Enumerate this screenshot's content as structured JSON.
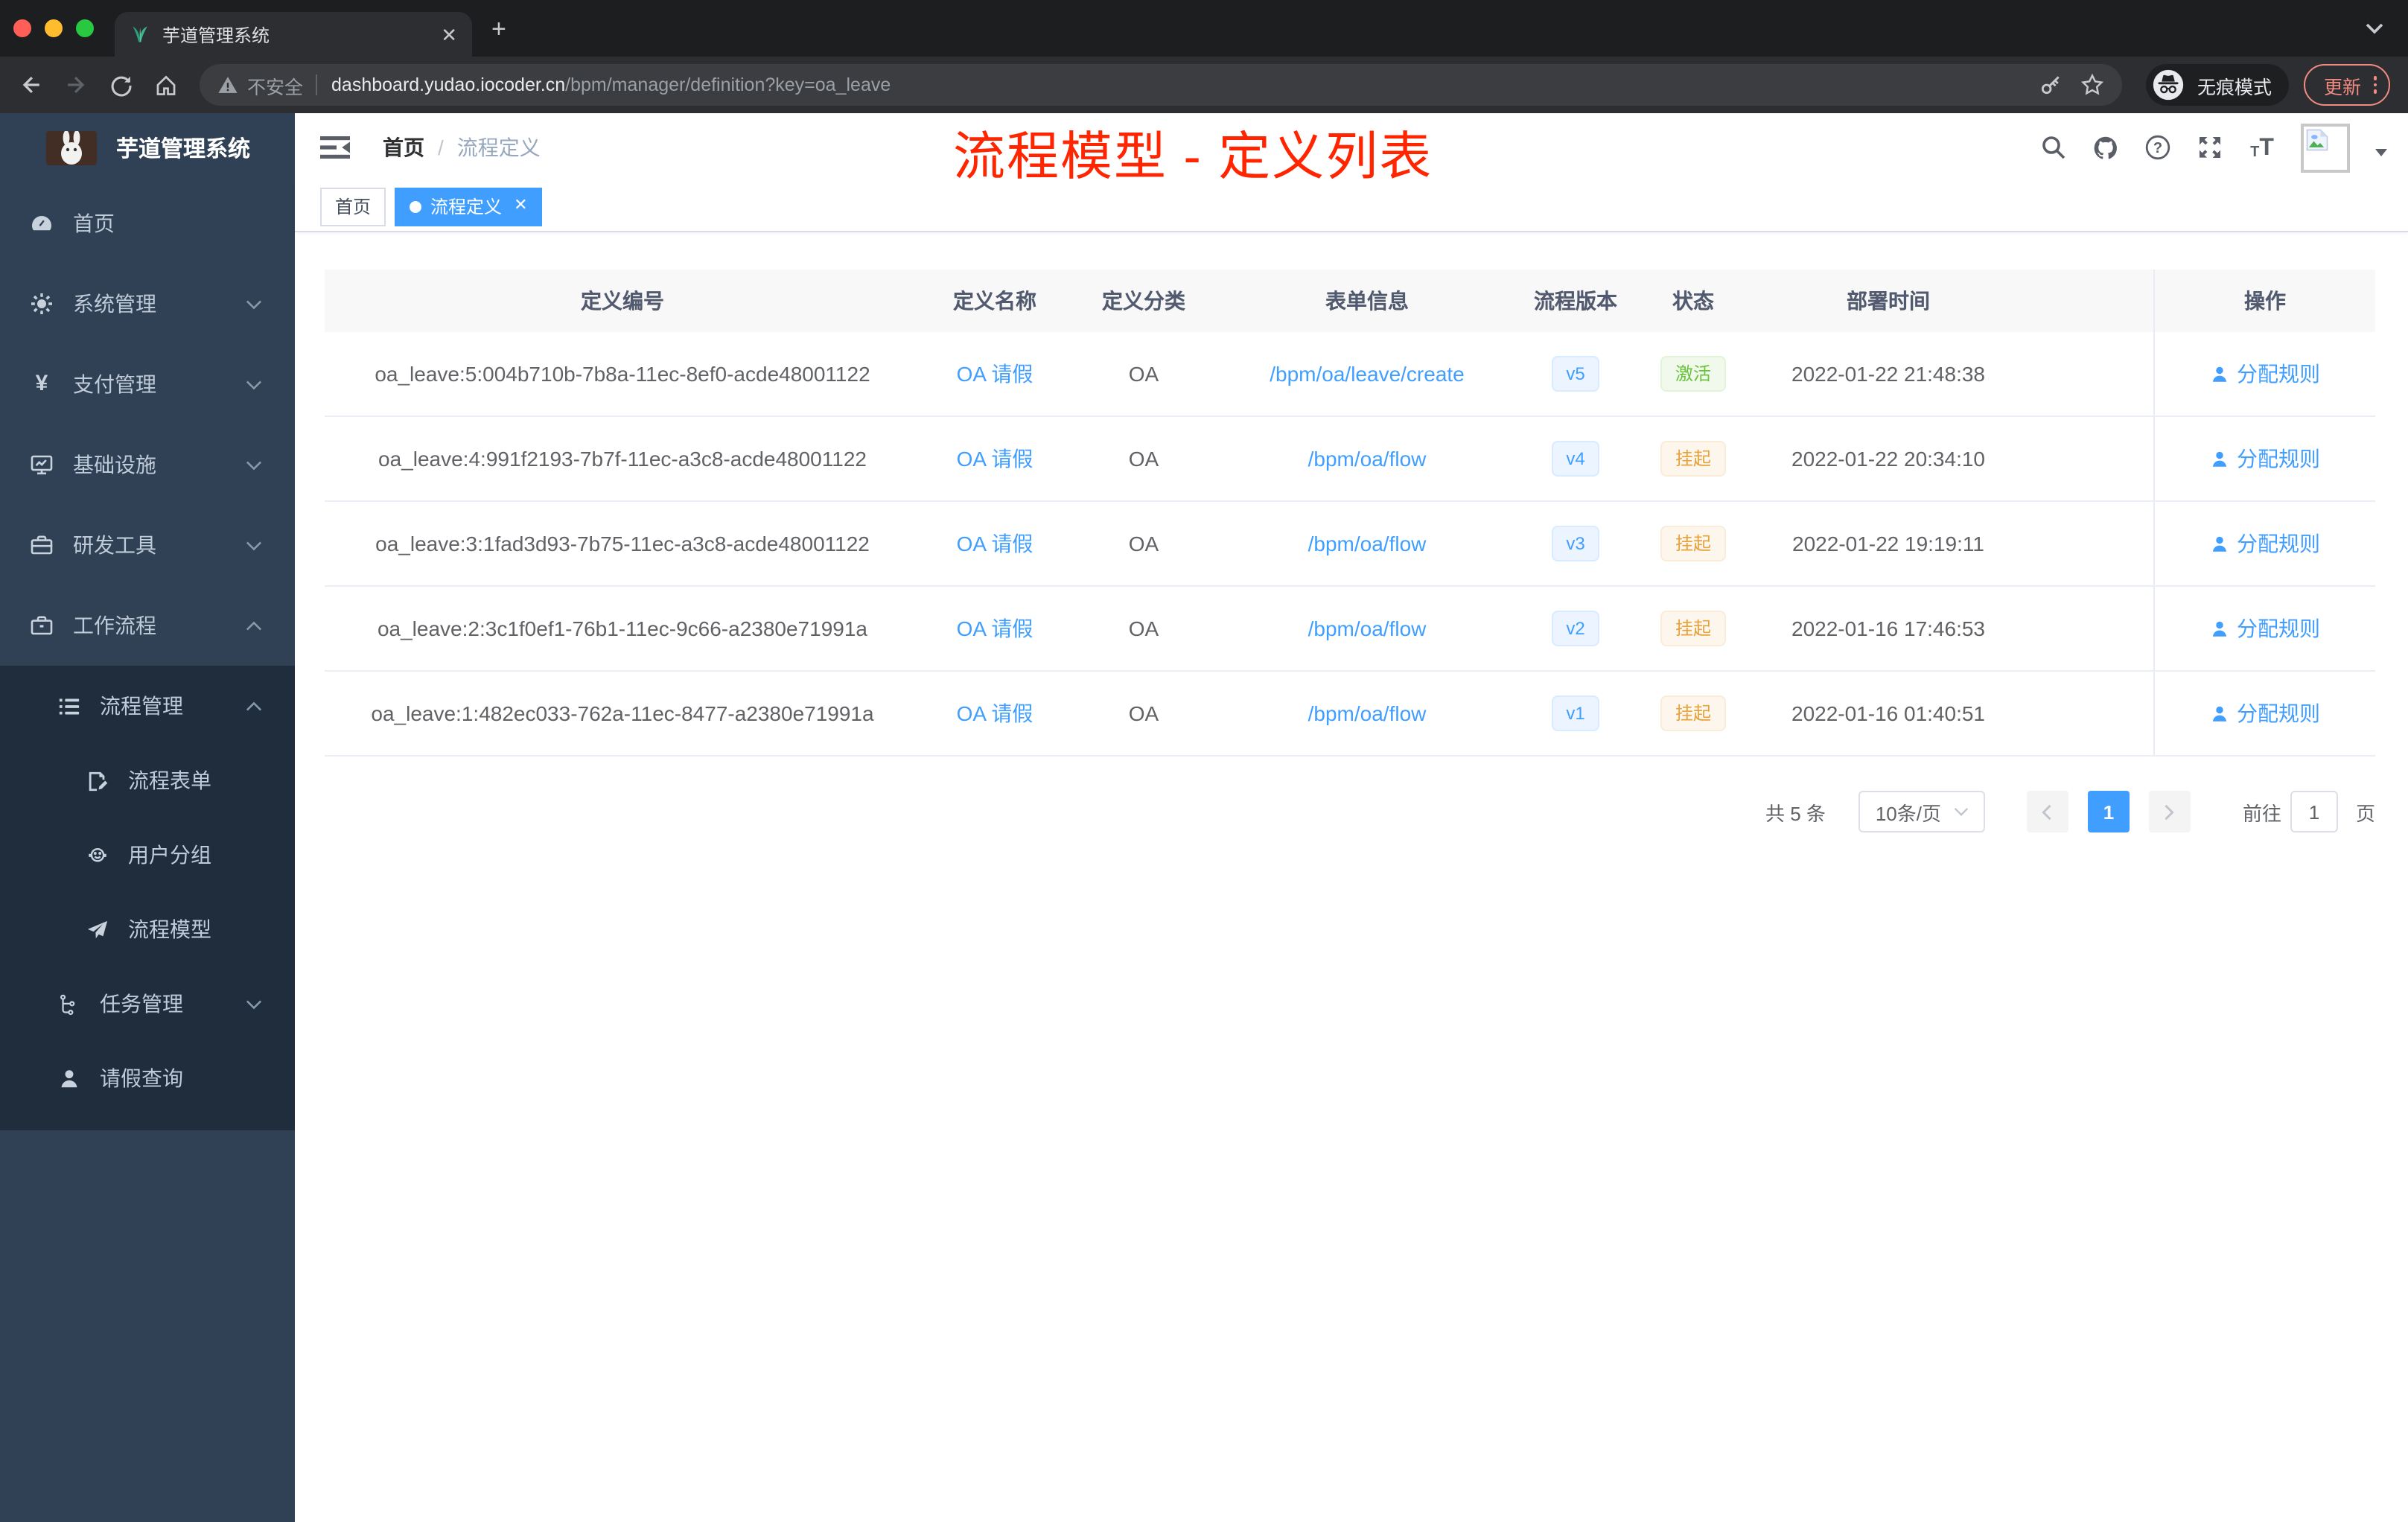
{
  "browser": {
    "tab_title": "芋道管理系统",
    "security_label": "不安全",
    "url_host": "dashboard.yudao.iocoder.cn",
    "url_path": "/bpm/manager/definition?key=oa_leave",
    "incognito_label": "无痕模式",
    "update_label": "更新"
  },
  "sidebar": {
    "logo_title": "芋道管理系统",
    "items": [
      {
        "label": "首页",
        "icon": "dashboard-icon",
        "level": 1
      },
      {
        "label": "系统管理",
        "icon": "gear-icon",
        "level": 1,
        "chevron": "down"
      },
      {
        "label": "支付管理",
        "icon": "yen-icon",
        "level": 1,
        "chevron": "down"
      },
      {
        "label": "基础设施",
        "icon": "monitor-icon",
        "level": 1,
        "chevron": "down"
      },
      {
        "label": "研发工具",
        "icon": "toolbox-icon",
        "level": 1,
        "chevron": "down"
      },
      {
        "label": "工作流程",
        "icon": "briefcase-icon",
        "level": 1,
        "chevron": "up"
      },
      {
        "label": "流程管理",
        "icon": "list-icon",
        "level": 2,
        "chevron": "up"
      },
      {
        "label": "流程表单",
        "icon": "form-icon",
        "level": 3
      },
      {
        "label": "用户分组",
        "icon": "people-icon",
        "level": 3
      },
      {
        "label": "流程模型",
        "icon": "send-icon",
        "level": 3
      },
      {
        "label": "任务管理",
        "icon": "tree-icon",
        "level": 2,
        "chevron": "down"
      },
      {
        "label": "请假查询",
        "icon": "user-icon",
        "level": 2
      }
    ]
  },
  "header": {
    "breadcrumb_home": "首页",
    "breadcrumb_sep": "/",
    "breadcrumb_current": "流程定义",
    "annotation": "流程模型 - 定义列表",
    "annotation_color": "#ff2500"
  },
  "tags": {
    "home": "首页",
    "active": "流程定义"
  },
  "table": {
    "columns": [
      "定义编号",
      "定义名称",
      "定义分类",
      "表单信息",
      "流程版本",
      "状态",
      "部署时间",
      "操作"
    ],
    "rows": [
      {
        "id": "oa_leave:5:004b710b-7b8a-11ec-8ef0-acde48001122",
        "name": "OA 请假",
        "category": "OA",
        "form": "/bpm/oa/leave/create",
        "version": "v5",
        "status": "激活",
        "status_type": "success",
        "time": "2022-01-22 21:48:38",
        "action": "分配规则"
      },
      {
        "id": "oa_leave:4:991f2193-7b7f-11ec-a3c8-acde48001122",
        "name": "OA 请假",
        "category": "OA",
        "form": "/bpm/oa/flow",
        "version": "v4",
        "status": "挂起",
        "status_type": "warning",
        "time": "2022-01-22 20:34:10",
        "action": "分配规则"
      },
      {
        "id": "oa_leave:3:1fad3d93-7b75-11ec-a3c8-acde48001122",
        "name": "OA 请假",
        "category": "OA",
        "form": "/bpm/oa/flow",
        "version": "v3",
        "status": "挂起",
        "status_type": "warning",
        "time": "2022-01-22 19:19:11",
        "action": "分配规则"
      },
      {
        "id": "oa_leave:2:3c1f0ef1-76b1-11ec-9c66-a2380e71991a",
        "name": "OA 请假",
        "category": "OA",
        "form": "/bpm/oa/flow",
        "version": "v2",
        "status": "挂起",
        "status_type": "warning",
        "time": "2022-01-16 17:46:53",
        "action": "分配规则"
      },
      {
        "id": "oa_leave:1:482ec033-762a-11ec-8477-a2380e71991a",
        "name": "OA 请假",
        "category": "OA",
        "form": "/bpm/oa/flow",
        "version": "v1",
        "status": "挂起",
        "status_type": "warning",
        "time": "2022-01-16 01:40:51",
        "action": "分配规则"
      }
    ]
  },
  "pagination": {
    "total": "共 5 条",
    "page_size": "10条/页",
    "current": "1",
    "goto_label": "前往",
    "goto_value": "1",
    "page_unit": "页"
  },
  "colors": {
    "accent": "#409eff",
    "success": "#67c23a",
    "warning": "#e6a23c",
    "sidebar_bg": "#304156",
    "submenu_bg": "#1f2d3d"
  }
}
